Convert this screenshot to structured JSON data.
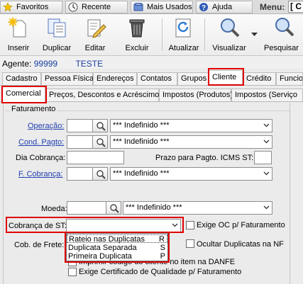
{
  "top_tabs": {
    "favoritos": "Favoritos",
    "recente": "Recente",
    "mais_usados": "Mais Usados",
    "ajuda": "Ajuda"
  },
  "menu": {
    "label": "Menu:",
    "value": "[ C"
  },
  "toolbar": {
    "inserir": "Inserir",
    "duplicar": "Duplicar",
    "editar": "Editar",
    "excluir": "Excluir",
    "atualizar": "Atualizar",
    "visualizar": "Visualizar",
    "pesquisar": "Pesquisar"
  },
  "agent": {
    "label": "Agente:",
    "code": "99999",
    "name": "TESTE"
  },
  "main_tabs": [
    "Cadastro",
    "Pessoa Física",
    "Endereços",
    "Contatos",
    "Grupos",
    "Cliente",
    "Crédito",
    "Funcior"
  ],
  "sub_tabs": [
    "Comercial",
    "Preços, Descontos e Acréscimos",
    "Impostos (Produtos)",
    "Impostos (Serviço"
  ],
  "form": {
    "group_title": "Faturamento",
    "operacao_label": "Operação:",
    "cond_pagto_label": "Cond. Pagto:",
    "dia_cobranca_label": "Dia Cobrança:",
    "prazo_label": "Prazo para Pagto. ICMS ST:",
    "f_cobranca_label": "F. Cobrança:",
    "moeda_label": "Moeda:",
    "cobranca_st_label": "Cobrança de ST:",
    "cob_frete_label": "Cob. de Frete:",
    "indefinido": "*** Indefinido ***",
    "exige_oc": "Exige OC p/ Faturamento",
    "ocultar_dup": "Ocultar Duplicatas na NF",
    "imprimir_item": "Imprimir código do cliente no item na DANFE",
    "exige_cert": "Exige Certificado de Qualidade p/ Faturamento"
  },
  "dropdown_options": [
    {
      "label": "Rateio nas Duplicatas",
      "code": "R"
    },
    {
      "label": "Duplicata Separada",
      "code": "S"
    },
    {
      "label": "Primeira Duplicata",
      "code": "P"
    }
  ],
  "colors": {
    "accent_red": "#e00000",
    "link_blue": "#1f3fb0"
  }
}
